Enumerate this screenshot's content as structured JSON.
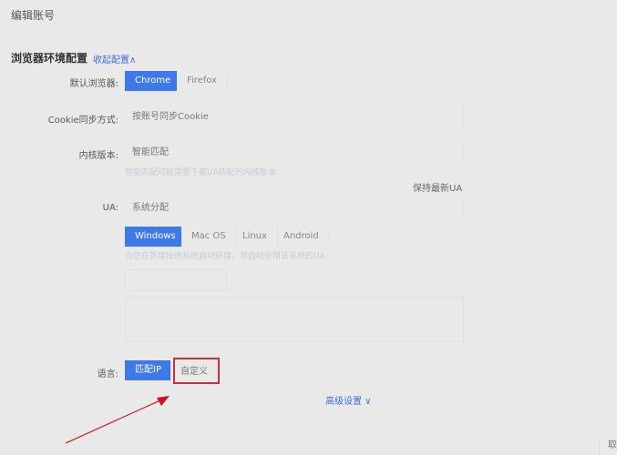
{
  "header": {
    "title": "编辑账号"
  },
  "section": {
    "title": "浏览器环境配置",
    "collapse_label": "收起配置∧"
  },
  "browser": {
    "label": "默认浏览器:",
    "options": [
      "Chrome",
      "Firefox"
    ]
  },
  "cookie": {
    "label": "Cookie同步方式:",
    "value": "按账号同步Cookie"
  },
  "kernel": {
    "label": "内核版本:",
    "value": "智能匹配",
    "hint": "智能匹配可能需要下载UA匹配的内核版本"
  },
  "ua": {
    "keep_latest": "保持最新UA",
    "label": "UA:",
    "value": "系统分配",
    "os_options": [
      "Windows",
      "Mac OS",
      "Linux",
      "Android"
    ],
    "hint": "当您在新建操作系统启动环境，将自动使用该系统的UA"
  },
  "language": {
    "label": "语言:",
    "options": [
      "匹配IP",
      "自定义"
    ]
  },
  "advanced": {
    "label": "高级设置 ∨"
  },
  "footer": {
    "cancel": "取"
  },
  "colors": {
    "accent": "#3f78e8",
    "highlight": "#c8313c"
  }
}
